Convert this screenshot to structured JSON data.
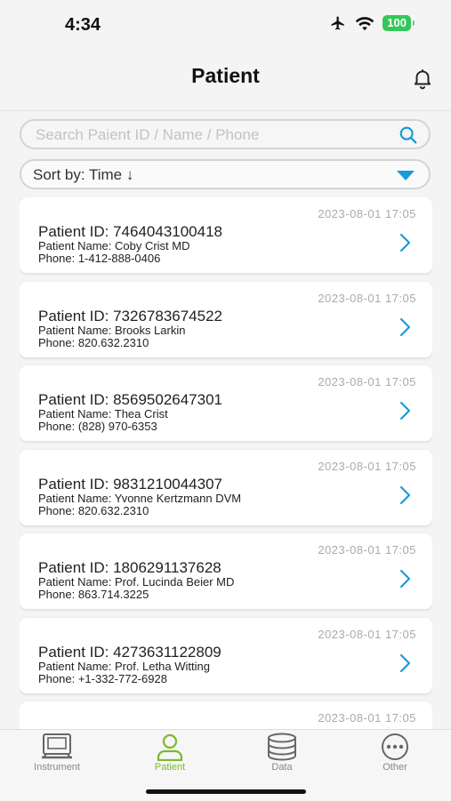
{
  "status_bar": {
    "time": "4:34",
    "battery": "100"
  },
  "header": {
    "title": "Patient"
  },
  "search": {
    "placeholder": "Search Paient ID / Name / Phone"
  },
  "sort": {
    "label": "Sort by: Time ↓"
  },
  "patients": [
    {
      "time": "2023-08-01 17:05",
      "id": "Patient ID: 7464043100418",
      "name": "Patient Name: Coby Crist MD",
      "phone": "Phone: 1-412-888-0406"
    },
    {
      "time": "2023-08-01 17:05",
      "id": "Patient ID: 7326783674522",
      "name": "Patient Name: Brooks Larkin",
      "phone": "Phone: 820.632.2310"
    },
    {
      "time": "2023-08-01 17:05",
      "id": "Patient ID: 8569502647301",
      "name": "Patient Name: Thea Crist",
      "phone": "Phone: (828) 970-6353"
    },
    {
      "time": "2023-08-01 17:05",
      "id": "Patient ID: 9831210044307",
      "name": "Patient Name: Yvonne Kertzmann DVM",
      "phone": "Phone: 820.632.2310"
    },
    {
      "time": "2023-08-01 17:05",
      "id": "Patient ID: 1806291137628",
      "name": "Patient Name: Prof. Lucinda Beier MD",
      "phone": "Phone: 863.714.3225"
    },
    {
      "time": "2023-08-01 17:05",
      "id": "Patient ID: 4273631122809",
      "name": "Patient Name: Prof. Letha Witting",
      "phone": "Phone: +1-332-772-6928"
    },
    {
      "time": "2023-08-01 17:05",
      "id": "",
      "name": "",
      "phone": ""
    }
  ],
  "tabs": [
    {
      "label": "Instrument",
      "icon": "instrument-icon",
      "active": false
    },
    {
      "label": "Patient",
      "icon": "patient-icon",
      "active": true
    },
    {
      "label": "Data",
      "icon": "database-icon",
      "active": false
    },
    {
      "label": "Other",
      "icon": "more-icon",
      "active": false
    }
  ],
  "colors": {
    "accent_blue": "#1a9bd7",
    "active_tab_green": "#7cb82f",
    "battery_green": "#34c759"
  }
}
